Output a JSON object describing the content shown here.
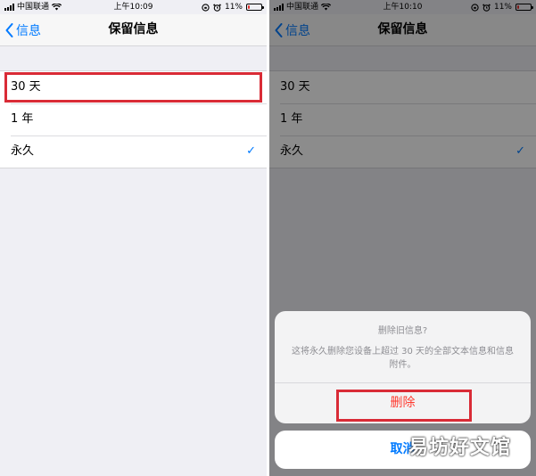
{
  "left": {
    "status": {
      "carrier": "中国联通",
      "time": "上午10:09",
      "battery": "11%",
      "battery_level": 0.11
    },
    "nav": {
      "back_label": "信息",
      "title": "保留信息"
    },
    "options": [
      {
        "label": "30 天"
      },
      {
        "label": "1 年"
      },
      {
        "label": "永久",
        "checkmark": "✓"
      }
    ]
  },
  "right": {
    "status": {
      "carrier": "中国联通",
      "time": "上午10:10",
      "battery": "11%",
      "battery_level": 0.11
    },
    "nav": {
      "back_label": "信息",
      "title": "保留信息"
    },
    "options": [
      {
        "label": "30 天"
      },
      {
        "label": "1 年"
      },
      {
        "label": "永久",
        "checkmark": "✓"
      }
    ],
    "action_sheet": {
      "title": "删除旧信息?",
      "message": "这将永久删除您设备上超过 30 天的全部文本信息和信息附件。",
      "delete_label": "删除",
      "cancel_label": "取消"
    },
    "watermark": "易坊好文馆"
  },
  "colors": {
    "accent": "#007aff",
    "destructive": "#ff3b30",
    "highlight_box": "#d92b36",
    "battery_low": "#e4312f"
  }
}
